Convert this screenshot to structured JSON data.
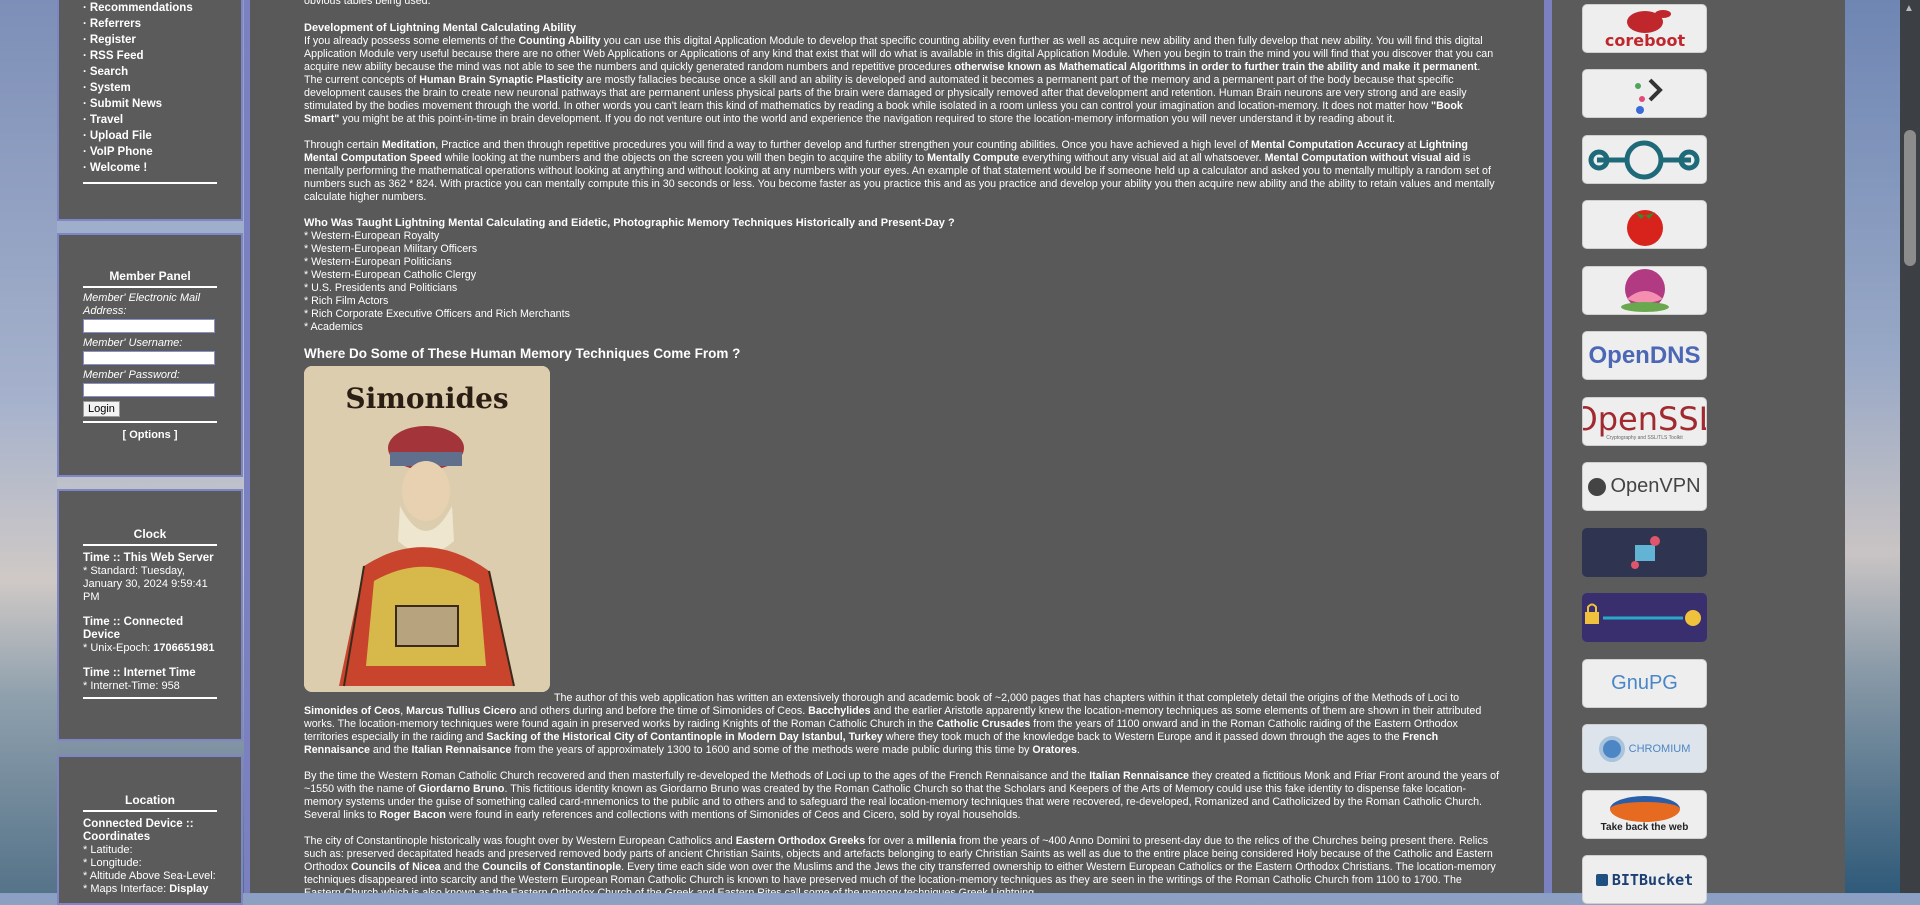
{
  "nav": {
    "items": [
      "Recommendations",
      "Referrers",
      "Register",
      "RSS Feed",
      "Search",
      "System",
      "Submit News",
      "Travel",
      "Upload File",
      "VoIP Phone",
      "Welcome !"
    ]
  },
  "member_panel": {
    "title": "Member Panel",
    "email_label": "Member' Electronic Mail Address:",
    "username_label": "Member' Username:",
    "password_label": "Member' Password:",
    "login_label": "Login",
    "options_label": "[ Options ]"
  },
  "clock": {
    "title": "Clock",
    "web_server_head": "Time :: This Web Server",
    "standard": "* Standard: Tuesday, January 30, 2024 9:59:41 PM",
    "connected_head": "Time :: Connected Device",
    "unix_label": "* Unix-Epoch: ",
    "unix_value": "1706651981",
    "internet_head": "Time :: Internet Time",
    "internet": "* Internet-Time: 958"
  },
  "location": {
    "title": "Location",
    "head": "Connected Device :: Coordinates",
    "latitude": "* Latitude:",
    "longitude": "* Longitude:",
    "altitude": "* Altitude Above Sea-Level:",
    "maps_label": "* Maps Interface: ",
    "maps_link": "Display"
  },
  "article": {
    "top_line": "obvious tables being used.",
    "dev_heading": "Development of Lightning Mental Calculating Ability",
    "dev_p1": "If you already possess some elements of the <b>Counting Ability</b> you can use this digital Application Module to develop that specific counting ability even further as well as acquire new ability and then fully develop that new ability. You will find this digital Application Module very useful because there are no other Web Applications or Applications of any kind that exist that will do what is available in this digital Application Module. When you begin to train the mind you will find that you discover that you can acquire new ability because the mind was not able to see the numbers and quickly generated random numbers and repetitive procedures <b>otherwise known as Mathematical Algorithms in order to further train the ability and make it permanent</b>. The current concepts of <b>Human Brain Synaptic Plasticity</b> are mostly fallacies because once a skill and an ability is developed and automated it becomes a permanent part of the memory and a permanent part of the body because that specific development causes the brain to create new neuronal pathways that are permanent unless physical parts of the brain were damaged or physically removed after that development and retention. Human Brain neurons are very strong and are easily stimulated by the bodies movement through the world. In other words you can't learn this kind of mathematics by reading a book while isolated in a room unless you can control your imagination and location-memory. It does not matter how <b>\"Book Smart\"</b> you might be at this point-in-time in brain development. If you do not venture out into the world and experience the navigation required to store the location-memory information you will never understand it by reading about it.",
    "dev_p2": "Through certain <b>Meditation</b>, Practice and then through repetitive procedures you will find a way to further develop and further strengthen your counting abilities. Once you have achieved a high level of <b>Mental Computation Accuracy</b> at <b>Lightning Mental Computation Speed</b> while looking at the numbers and the objects on the screen you will then begin to acquire the ability to <b>Mentally Compute</b> everything without any visual aid at all whatsoever. <b>Mental Computation without visual aid</b> is mentally performing the mathematical operations without looking at anything and without looking at any numbers with your eyes. An example of that statement would be if someone held up a calculator and asked you to mentally multiply a random set of numbers such as 362 * 824. With practice you can mentally compute this in 30 seconds or less. You become faster as you practice this and as you practice and develop your ability you then acquire new ability and the ability to retain values and mentally calculate higher numbers.",
    "taught_heading": "Who Was Taught Lightning Mental Calculating and Eidetic, Photographic Memory Techniques Historically and Present-Day ?",
    "taught_list": [
      "* Western-European Royalty",
      "* Western-European Military Officers",
      "* Western-European Politicians",
      "* Western-European Catholic Clergy",
      "* U.S. Presidents and Politicians",
      "* Rich Film Actors",
      "* Rich Corporate Executive Officers and Rich Merchants",
      "* Academics"
    ],
    "where_heading": "Where Do Some of These Human Memory Techniques Come From ?",
    "portrait_caption": "Simonides",
    "where_p1": "The author of this web application has written an extensively thorough and academic book of ~2,000 pages that has chapters within it that completely detail the origins of the Methods of Loci to <b>Simonides of Ceos</b>, <b>Marcus Tullius Cicero</b> and others during and before the time of Simonides of Ceos. <b>Bacchylides</b> and the earlier Aristotle apparently knew the location-memory techniques as some elements of them are shown in their attributed works. The location-memory techniques were found again in preserved works by raiding Knights of the Roman Catholic Church in the <b>Catholic Crusades</b> from the years of 1100 onward and in the Roman Catholic raiding of the Eastern Orthodox territories especially in the raiding and <b>Sacking of the Historical City of Contantinople in Modern Day Istanbul, Turkey</b> where they took much of the knowledge back to Western Europe and it passed down through the ages to the <b>French Rennaisance</b> and the <b>Italian Rennaisance</b> from the years of approximately 1300 to 1600 and some of the methods were made public during this time by <b>Oratores</b>.",
    "where_p2": "By the time the Western Roman Catholic Church recovered and then masterfully re-developed the Methods of Loci up to the ages of the French Rennaisance and the <b>Italian Rennaisance</b> they created a fictitious Monk and Friar Front around the years of ~1550 with the name of <b>Giordarno Bruno</b>. This fictitious identity known as Giordarno Bruno was created by the Roman Catholic Church so that the Scholars and Keepers of the Arts of Memory could use this fake identity to dispense fake location-memory systems under the guise of something called card-mnemonics to the public and to others and to safeguard the real location-memory techniques that were recovered, re-developed, Romanized and Catholicized by the Roman Catholic Church. Several links to <b>Roger Bacon</b> were found in early references and collections with mentions of Simonides of Ceos and Cicero, sold by royal households.",
    "where_p3": "The city of Constantinople historically was fought over by Western European Catholics and <b>Eastern Orthodox Greeks</b> for over a <b>millenia</b> from the years of ~400 Anno Domini to present-day due to the relics of the Churches being present there. Relics such as: preserved decapitated heads and preserved removed body parts of ancient Christian Saints, objects and artefacts belonging to early Christian Saints as well as due to the entire place being considered Holy because of the Catholic and Eastern Orthodox <b>Councils of Nicea</b> and the <b>Councils of Constantinople</b>. Every time each side won over the Muslims and the Jews the city transferred ownership to either Western European Catholics or the Eastern Orthodox Christians. The location-memory techniques disappeared into scarcity and the Western European Roman Catholic Church is known to have preserved much of the location-memory techniques as they are seen in the writings of the Roman Catholic Church from 1100 to 1700. The Eastern Church which is also known as the Eastern Orthodox Church of the Greek and Eastern Rites call some of the memory techniques Greek Lightning."
  },
  "badges": [
    {
      "name": "coreboot-logo",
      "label": "coreboot"
    },
    {
      "name": "kodi-logo",
      "label": ""
    },
    {
      "name": "lineageos-logo",
      "label": ""
    },
    {
      "name": "tomato-logo",
      "label": ""
    },
    {
      "name": "lotus-logo",
      "label": ""
    },
    {
      "name": "opendns-logo",
      "label": "OpenDNS"
    },
    {
      "name": "openssl-logo",
      "label": "OpenSSL",
      "sub": "Cryptography and SSL/TLS Toolkit"
    },
    {
      "name": "openvpn-logo",
      "label": "OpenVPN"
    },
    {
      "name": "network-lock-logo",
      "label": ""
    },
    {
      "name": "gpg-key-logo",
      "label": ""
    },
    {
      "name": "gnupg-logo",
      "label": "GnuPG"
    },
    {
      "name": "chromium-logo",
      "label": "CHROMIUM"
    },
    {
      "name": "firefox-logo",
      "label": "Take back the web"
    },
    {
      "name": "bitbucket-logo",
      "label": "BITBucket"
    }
  ],
  "colors": {
    "panel_bg": "#5b5b5b",
    "border_accent": "#7a80c0",
    "text": "#ffffff",
    "coreboot_red": "#c0272d",
    "opendns_blue": "#4b67b5",
    "openssl_red": "#a12a2f",
    "bitbucket_blue": "#1c3f74"
  }
}
